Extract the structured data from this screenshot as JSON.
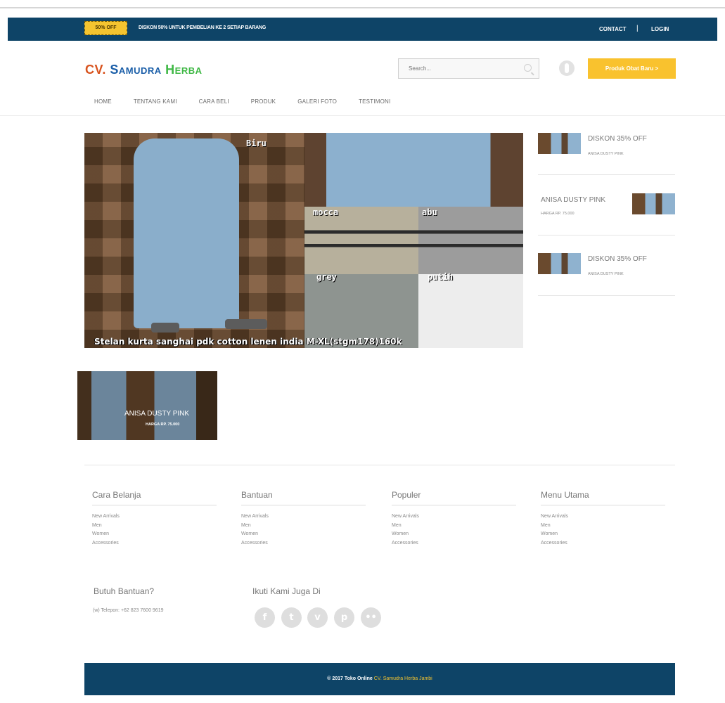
{
  "topbar": {
    "badge": "50% OFF",
    "promo": "DISKON 50% UNTUK PEMBELIAN KE 2 SETIAP BARANG",
    "contact": "CONTACT",
    "separator": "|",
    "login": "LOGIN"
  },
  "header": {
    "logo_part1": "CV.",
    "logo_part2": "Samudra",
    "logo_part3": "Herba",
    "search_placeholder": "Search...",
    "cta_label": "Produk Obat Baru  >"
  },
  "nav": {
    "items": [
      "Home",
      "Tentang Kami",
      "Cara Beli",
      "Produk",
      "Galeri Foto",
      "Testimoni"
    ]
  },
  "slider": {
    "tags": [
      "Biru",
      "mocca",
      "abu",
      "grey",
      "putih"
    ],
    "caption": "Stelan kurta sanghai pdk cotton lenen india M-XL(stgm178)160k"
  },
  "sidebar": {
    "items": [
      {
        "title": "DISKON 35% OFF",
        "sub": "ANISA DUSTY PINK"
      },
      {
        "title": "ANISA DUSTY PINK",
        "sub": "HARGA RP. 75.000"
      },
      {
        "title": "DISKON 35% OFF",
        "sub": "ANISA DUSTY PINK"
      }
    ]
  },
  "thumbnail": {
    "title": "ANISA DUSTY PINK",
    "sub": "HARGA RP. 75.000"
  },
  "footer_columns": [
    {
      "title": "Cara Belanja",
      "links": [
        "New Arrivals",
        "Men",
        "Women",
        "Accessories"
      ]
    },
    {
      "title": "Bantuan",
      "links": [
        "New Arrivals",
        "Men",
        "Women",
        "Accessories"
      ]
    },
    {
      "title": "Populer",
      "links": [
        "New Arrivals",
        "Men",
        "Women",
        "Accessories"
      ]
    },
    {
      "title": "Menu Utama",
      "links": [
        "New Arrivals",
        "Men",
        "Women",
        "Accessories"
      ]
    }
  ],
  "help": {
    "title": "Butuh Bantuan?",
    "phone": "(w) Telepon: +62 823 7600 9619"
  },
  "social": {
    "title": "Ikuti Kami Juga Di",
    "icons": [
      "facebook-icon",
      "twitter-icon",
      "vimeo-icon",
      "pinterest-icon",
      "flickr-icon"
    ],
    "glyphs": [
      "f",
      "t",
      "v",
      "p",
      "••"
    ]
  },
  "footer": {
    "copyright": "© 2017 Toko Online",
    "brand": "CV. Samudra Herba Jambi"
  },
  "colors": {
    "navy": "#0e4467",
    "accent_yellow": "#f9c22e"
  }
}
